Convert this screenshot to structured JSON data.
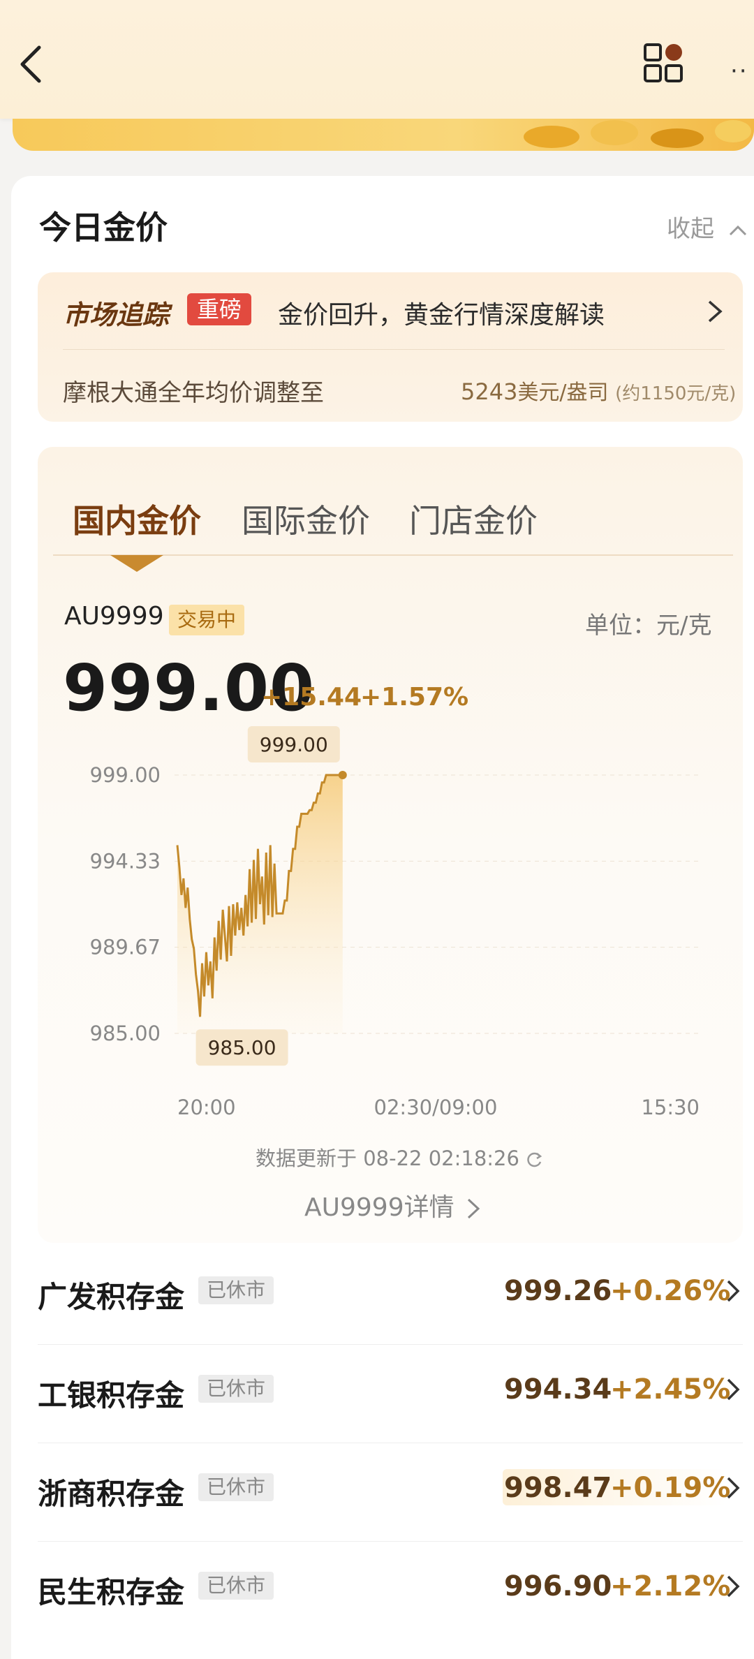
{
  "header": {
    "more_label": "··"
  },
  "card": {
    "title": "今日金价",
    "collapse_label": "收起"
  },
  "news": {
    "brand": "市场追踪",
    "badge": "重磅",
    "headline": "金价回升，黄金行情深度解读",
    "sub_left": "摩根大通全年均价调整至",
    "sub_value": "5243",
    "sub_unit": "美元/盎司",
    "sub_note": "(约1150元/克)"
  },
  "tabs": [
    "国内金价",
    "国际金价",
    "门店金价"
  ],
  "quote": {
    "code": "AU9999",
    "status": "交易中",
    "unit": "单位：元/克",
    "price": "999.00",
    "change_abs": "+15.44",
    "change_pct": "+1.57%"
  },
  "chart_data": {
    "type": "line",
    "series": [
      {
        "x": [
          0,
          1,
          2,
          3,
          4,
          5,
          6,
          7,
          8,
          9,
          10,
          11,
          12,
          13,
          14,
          15,
          16,
          17,
          18,
          19,
          20,
          21,
          22,
          23,
          24,
          25,
          26,
          27,
          28,
          29,
          30,
          31,
          32,
          33,
          34,
          35,
          36,
          37,
          38,
          39,
          40,
          41,
          42,
          43,
          44,
          45,
          46,
          47,
          48,
          49,
          50,
          51,
          52,
          53,
          54,
          55,
          56,
          57,
          58,
          59,
          60,
          61,
          62,
          63,
          64,
          65,
          66,
          67,
          68,
          69,
          70,
          71,
          72,
          73,
          74,
          75,
          76,
          77,
          78,
          79,
          80
        ],
        "values": [
          995.2,
          994.0,
          992.5,
          993.4,
          991.8,
          992.9,
          991.2,
          990.1,
          989.6,
          988.2,
          987.3,
          985.9,
          988.8,
          987.0,
          989.4,
          987.6,
          988.9,
          986.9,
          990.2,
          988.4,
          991.1,
          989.0,
          991.7,
          990.3,
          988.9,
          991.9,
          989.2,
          992.0,
          990.3,
          992.1,
          990.6,
          991.8,
          990.3,
          992.5,
          990.8,
          993.9,
          991.0,
          994.4,
          991.2,
          995.0,
          992.0,
          993.5,
          990.9,
          994.8,
          991.4,
          995.2,
          991.3,
          994.2,
          991.5,
          991.5,
          991.5,
          991.5,
          992.2,
          992.2,
          993.8,
          993.8,
          995.0,
          995.0,
          996.2,
          996.2,
          996.9,
          996.9,
          996.9,
          996.9,
          997.1,
          997.1,
          997.5,
          997.5,
          998.0,
          998.0,
          998.6,
          998.6,
          999.0,
          999.0,
          999.0,
          999.0,
          999.0,
          999.0,
          999.0,
          999.0,
          999.0
        ]
      }
    ],
    "y_ticks": [
      "999.00",
      "994.33",
      "989.67",
      "985.00"
    ],
    "ylim": [
      985.0,
      999.0
    ],
    "x_ticks": [
      "20:00",
      "02:30/09:00",
      "15:30"
    ],
    "max_label": "999.00",
    "min_label": "985.00",
    "grid": true
  },
  "update_text": "数据更新于 08-22 02:18:26",
  "detail_link": "AU9999详情",
  "rows": [
    {
      "name": "广发积存金",
      "status": "已休市",
      "price": "999.26",
      "change": "+0.26%"
    },
    {
      "name": "工银积存金",
      "status": "已休市",
      "price": "994.34",
      "change": "+2.45%"
    },
    {
      "name": "浙商积存金",
      "status": "已休市",
      "price": "998.47",
      "change": "+0.19%"
    },
    {
      "name": "民生积存金",
      "status": "已休市",
      "price": "996.90",
      "change": "+2.12%"
    }
  ]
}
